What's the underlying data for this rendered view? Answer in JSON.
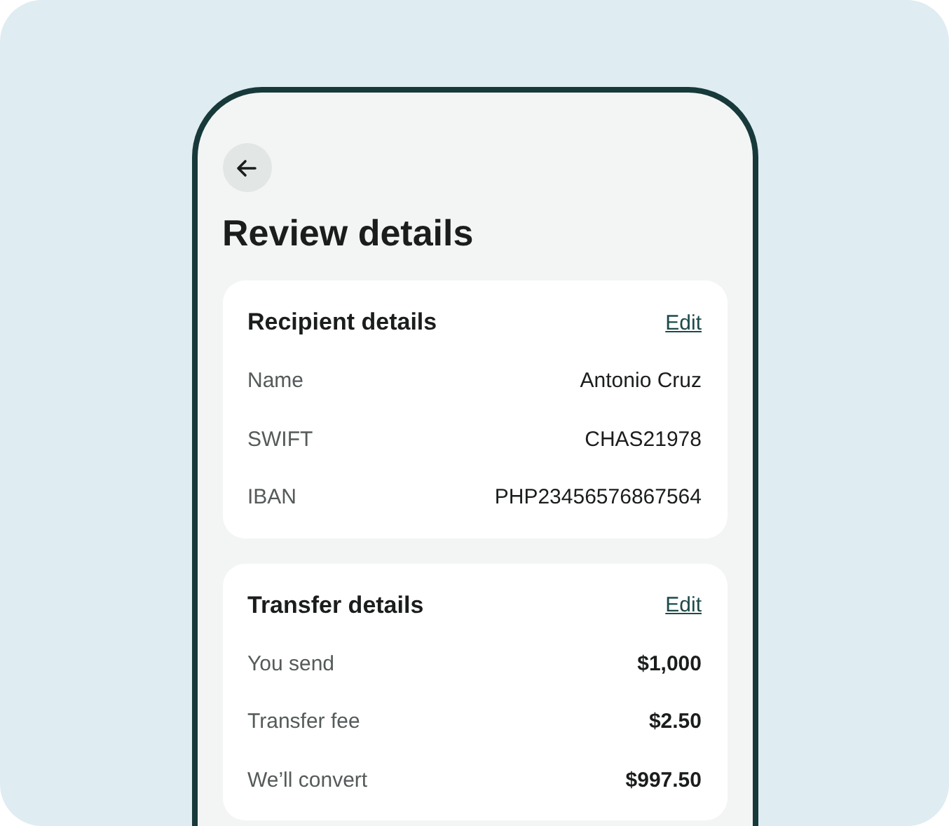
{
  "title": "Review details",
  "sections": [
    {
      "title": "Recipient details",
      "action": "Edit",
      "rows": [
        {
          "label": "Name",
          "value": "Antonio Cruz"
        },
        {
          "label": "SWIFT",
          "value": "CHAS21978"
        },
        {
          "label": "IBAN",
          "value": "PHP23456576867564"
        }
      ]
    },
    {
      "title": "Transfer details",
      "action": "Edit",
      "rows": [
        {
          "label": "You send",
          "value": "$1,000"
        },
        {
          "label": "Transfer fee",
          "value": "$2.50"
        },
        {
          "label": "We’ll convert",
          "value": "$997.50"
        }
      ]
    }
  ]
}
